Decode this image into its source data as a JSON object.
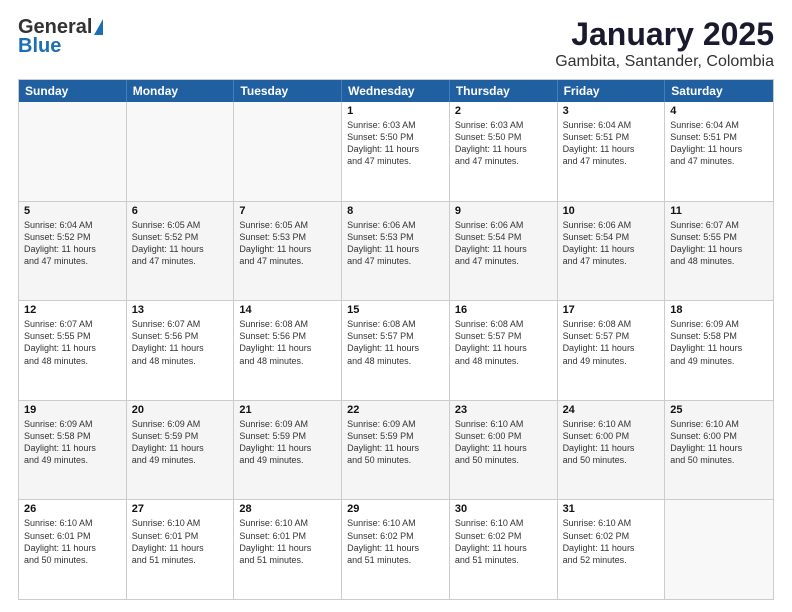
{
  "header": {
    "logo_general": "General",
    "logo_blue": "Blue",
    "title": "January 2025",
    "subtitle": "Gambita, Santander, Colombia"
  },
  "days_of_week": [
    "Sunday",
    "Monday",
    "Tuesday",
    "Wednesday",
    "Thursday",
    "Friday",
    "Saturday"
  ],
  "weeks": [
    [
      {
        "day": "",
        "lines": []
      },
      {
        "day": "",
        "lines": []
      },
      {
        "day": "",
        "lines": []
      },
      {
        "day": "1",
        "lines": [
          "Sunrise: 6:03 AM",
          "Sunset: 5:50 PM",
          "Daylight: 11 hours",
          "and 47 minutes."
        ]
      },
      {
        "day": "2",
        "lines": [
          "Sunrise: 6:03 AM",
          "Sunset: 5:50 PM",
          "Daylight: 11 hours",
          "and 47 minutes."
        ]
      },
      {
        "day": "3",
        "lines": [
          "Sunrise: 6:04 AM",
          "Sunset: 5:51 PM",
          "Daylight: 11 hours",
          "and 47 minutes."
        ]
      },
      {
        "day": "4",
        "lines": [
          "Sunrise: 6:04 AM",
          "Sunset: 5:51 PM",
          "Daylight: 11 hours",
          "and 47 minutes."
        ]
      }
    ],
    [
      {
        "day": "5",
        "lines": [
          "Sunrise: 6:04 AM",
          "Sunset: 5:52 PM",
          "Daylight: 11 hours",
          "and 47 minutes."
        ]
      },
      {
        "day": "6",
        "lines": [
          "Sunrise: 6:05 AM",
          "Sunset: 5:52 PM",
          "Daylight: 11 hours",
          "and 47 minutes."
        ]
      },
      {
        "day": "7",
        "lines": [
          "Sunrise: 6:05 AM",
          "Sunset: 5:53 PM",
          "Daylight: 11 hours",
          "and 47 minutes."
        ]
      },
      {
        "day": "8",
        "lines": [
          "Sunrise: 6:06 AM",
          "Sunset: 5:53 PM",
          "Daylight: 11 hours",
          "and 47 minutes."
        ]
      },
      {
        "day": "9",
        "lines": [
          "Sunrise: 6:06 AM",
          "Sunset: 5:54 PM",
          "Daylight: 11 hours",
          "and 47 minutes."
        ]
      },
      {
        "day": "10",
        "lines": [
          "Sunrise: 6:06 AM",
          "Sunset: 5:54 PM",
          "Daylight: 11 hours",
          "and 47 minutes."
        ]
      },
      {
        "day": "11",
        "lines": [
          "Sunrise: 6:07 AM",
          "Sunset: 5:55 PM",
          "Daylight: 11 hours",
          "and 48 minutes."
        ]
      }
    ],
    [
      {
        "day": "12",
        "lines": [
          "Sunrise: 6:07 AM",
          "Sunset: 5:55 PM",
          "Daylight: 11 hours",
          "and 48 minutes."
        ]
      },
      {
        "day": "13",
        "lines": [
          "Sunrise: 6:07 AM",
          "Sunset: 5:56 PM",
          "Daylight: 11 hours",
          "and 48 minutes."
        ]
      },
      {
        "day": "14",
        "lines": [
          "Sunrise: 6:08 AM",
          "Sunset: 5:56 PM",
          "Daylight: 11 hours",
          "and 48 minutes."
        ]
      },
      {
        "day": "15",
        "lines": [
          "Sunrise: 6:08 AM",
          "Sunset: 5:57 PM",
          "Daylight: 11 hours",
          "and 48 minutes."
        ]
      },
      {
        "day": "16",
        "lines": [
          "Sunrise: 6:08 AM",
          "Sunset: 5:57 PM",
          "Daylight: 11 hours",
          "and 48 minutes."
        ]
      },
      {
        "day": "17",
        "lines": [
          "Sunrise: 6:08 AM",
          "Sunset: 5:57 PM",
          "Daylight: 11 hours",
          "and 49 minutes."
        ]
      },
      {
        "day": "18",
        "lines": [
          "Sunrise: 6:09 AM",
          "Sunset: 5:58 PM",
          "Daylight: 11 hours",
          "and 49 minutes."
        ]
      }
    ],
    [
      {
        "day": "19",
        "lines": [
          "Sunrise: 6:09 AM",
          "Sunset: 5:58 PM",
          "Daylight: 11 hours",
          "and 49 minutes."
        ]
      },
      {
        "day": "20",
        "lines": [
          "Sunrise: 6:09 AM",
          "Sunset: 5:59 PM",
          "Daylight: 11 hours",
          "and 49 minutes."
        ]
      },
      {
        "day": "21",
        "lines": [
          "Sunrise: 6:09 AM",
          "Sunset: 5:59 PM",
          "Daylight: 11 hours",
          "and 49 minutes."
        ]
      },
      {
        "day": "22",
        "lines": [
          "Sunrise: 6:09 AM",
          "Sunset: 5:59 PM",
          "Daylight: 11 hours",
          "and 50 minutes."
        ]
      },
      {
        "day": "23",
        "lines": [
          "Sunrise: 6:10 AM",
          "Sunset: 6:00 PM",
          "Daylight: 11 hours",
          "and 50 minutes."
        ]
      },
      {
        "day": "24",
        "lines": [
          "Sunrise: 6:10 AM",
          "Sunset: 6:00 PM",
          "Daylight: 11 hours",
          "and 50 minutes."
        ]
      },
      {
        "day": "25",
        "lines": [
          "Sunrise: 6:10 AM",
          "Sunset: 6:00 PM",
          "Daylight: 11 hours",
          "and 50 minutes."
        ]
      }
    ],
    [
      {
        "day": "26",
        "lines": [
          "Sunrise: 6:10 AM",
          "Sunset: 6:01 PM",
          "Daylight: 11 hours",
          "and 50 minutes."
        ]
      },
      {
        "day": "27",
        "lines": [
          "Sunrise: 6:10 AM",
          "Sunset: 6:01 PM",
          "Daylight: 11 hours",
          "and 51 minutes."
        ]
      },
      {
        "day": "28",
        "lines": [
          "Sunrise: 6:10 AM",
          "Sunset: 6:01 PM",
          "Daylight: 11 hours",
          "and 51 minutes."
        ]
      },
      {
        "day": "29",
        "lines": [
          "Sunrise: 6:10 AM",
          "Sunset: 6:02 PM",
          "Daylight: 11 hours",
          "and 51 minutes."
        ]
      },
      {
        "day": "30",
        "lines": [
          "Sunrise: 6:10 AM",
          "Sunset: 6:02 PM",
          "Daylight: 11 hours",
          "and 51 minutes."
        ]
      },
      {
        "day": "31",
        "lines": [
          "Sunrise: 6:10 AM",
          "Sunset: 6:02 PM",
          "Daylight: 11 hours",
          "and 52 minutes."
        ]
      },
      {
        "day": "",
        "lines": []
      }
    ]
  ]
}
